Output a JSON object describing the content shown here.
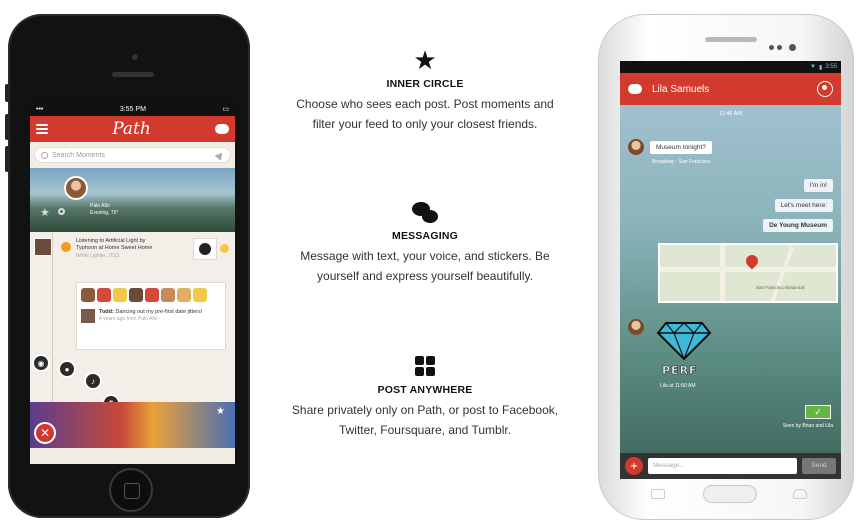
{
  "features": [
    {
      "icon": "star-icon",
      "title": "INNER CIRCLE",
      "text": "Choose who sees each post. Post moments and filter your feed to only your closest friends."
    },
    {
      "icon": "chat-bubbles-icon",
      "title": "MESSAGING",
      "text": "Message with text, your voice, and stickers. Be yourself and express yourself beautifully."
    },
    {
      "icon": "share-grid-icon",
      "title": "POST ANYWHERE",
      "text": "Share privately only on Path, or post to Facebook, Twitter, Foursquare, and Tumblr."
    }
  ],
  "iphone": {
    "status_time": "3:55 PM",
    "app_name": "Path",
    "search_placeholder": "Search Moments",
    "profile_caption": "Palo Alto",
    "profile_sub": "Evening, 75°",
    "moment_text": "Listening to Artificial Light by Typhoon at Home Sweet Home",
    "moment_meta": "White Lighter, 2013",
    "comment_author": "Todd:",
    "comment_text": "Dancing out my pre-first date jitters!",
    "comment_meta": "4 years ago from Palo Alto"
  },
  "android": {
    "status_time": "3:55",
    "contact_name": "Lila Samuels",
    "time_label": "11:46 AM",
    "messages": {
      "m1": "Museum tonight?",
      "m1_meta": "Broadway · San Francisco",
      "m2": "I'm in!",
      "m3": "Let's meet here:",
      "m4": "De Young Museum",
      "sticker_meta": "Lila at 11:50 AM",
      "seen": "Seen by Brian and Lila"
    },
    "map_label": "San Francisco Botanical",
    "sticker_text": "PERF",
    "compose_placeholder": "Message...",
    "send_label": "Send"
  },
  "colors": {
    "brand_red": "#d33a2e",
    "ok_green": "#64b542"
  }
}
